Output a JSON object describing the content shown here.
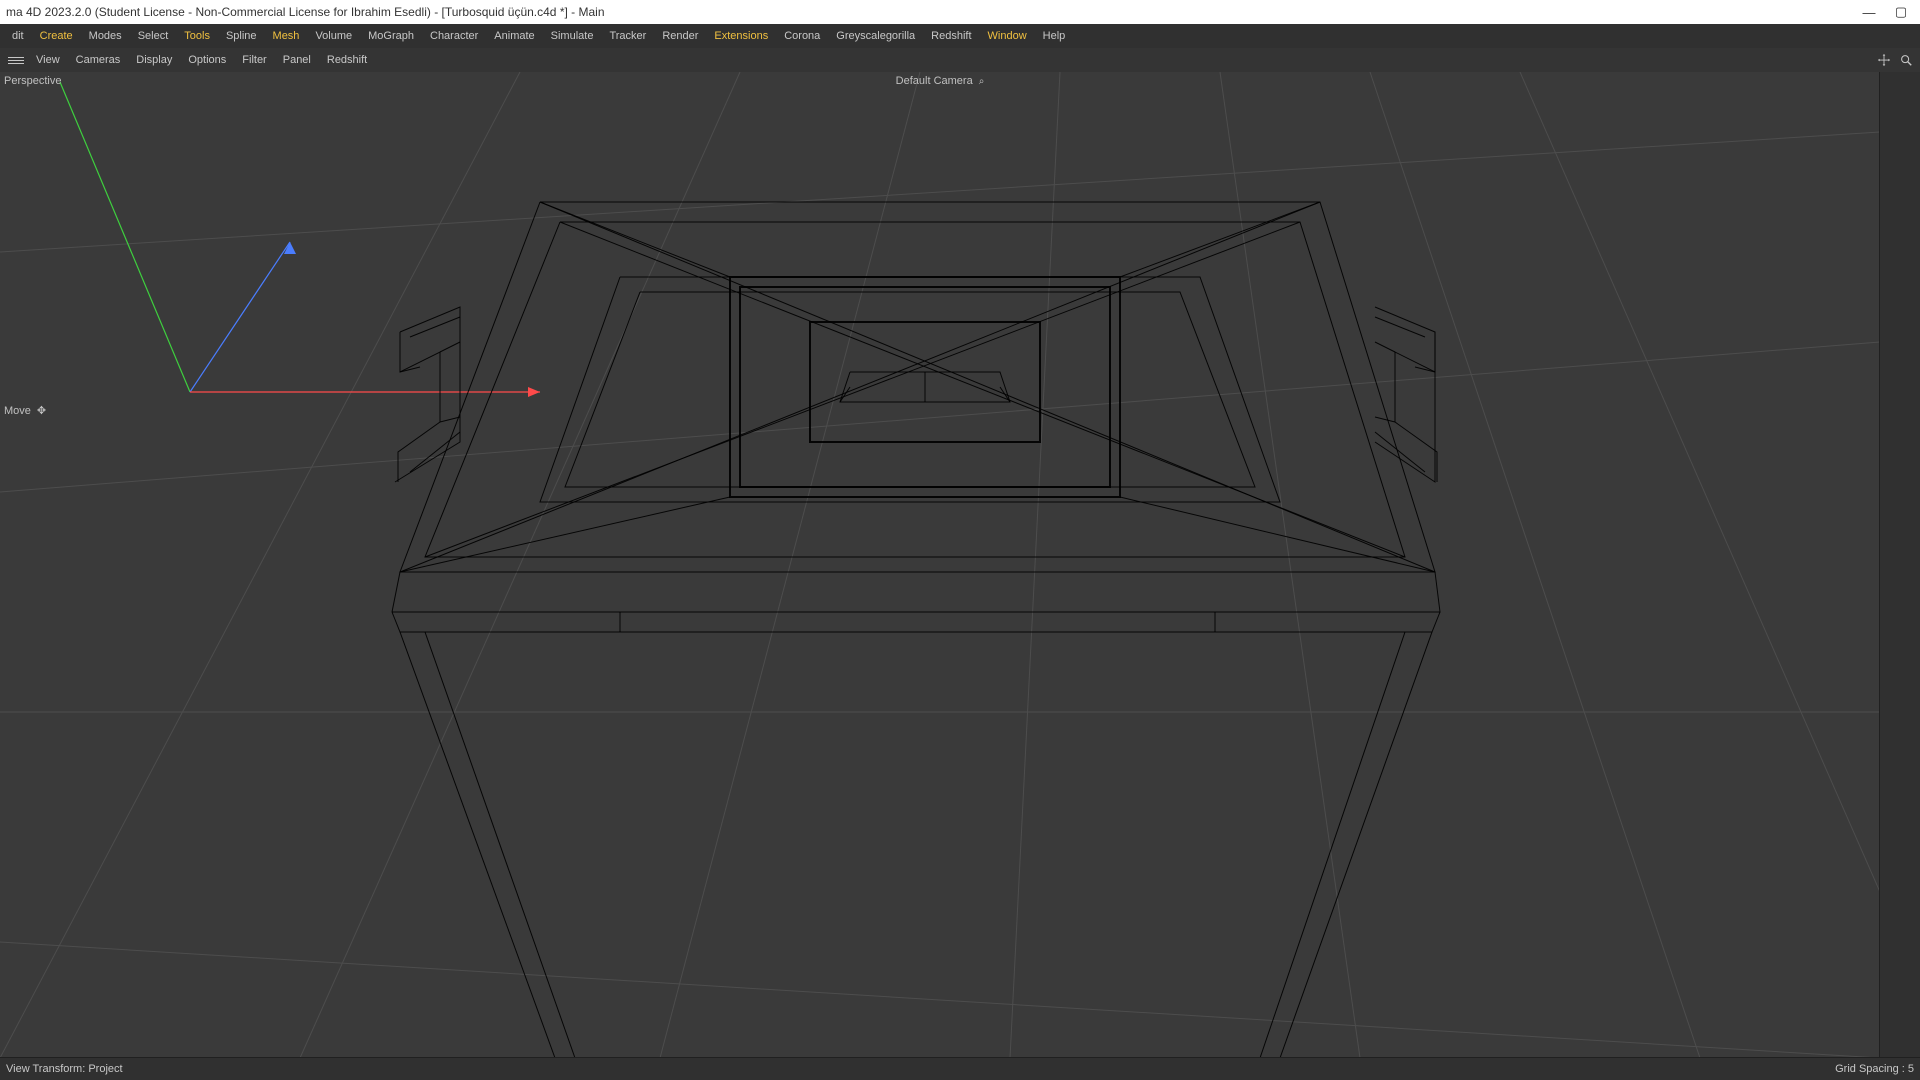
{
  "title_bar": {
    "text": "ma 4D 2023.2.0 (Student License - Non-Commercial License for Ibrahim Esedli) - [Turbosquid üçün.c4d *] - Main"
  },
  "main_menu": {
    "items": [
      {
        "label": "dit",
        "highlight": false
      },
      {
        "label": "Create",
        "highlight": true
      },
      {
        "label": "Modes",
        "highlight": false
      },
      {
        "label": "Select",
        "highlight": false
      },
      {
        "label": "Tools",
        "highlight": true
      },
      {
        "label": "Spline",
        "highlight": false
      },
      {
        "label": "Mesh",
        "highlight": true
      },
      {
        "label": "Volume",
        "highlight": false
      },
      {
        "label": "MoGraph",
        "highlight": false
      },
      {
        "label": "Character",
        "highlight": false
      },
      {
        "label": "Animate",
        "highlight": false
      },
      {
        "label": "Simulate",
        "highlight": false
      },
      {
        "label": "Tracker",
        "highlight": false
      },
      {
        "label": "Render",
        "highlight": false
      },
      {
        "label": "Extensions",
        "highlight": true
      },
      {
        "label": "Corona",
        "highlight": false
      },
      {
        "label": "Greyscalegorilla",
        "highlight": false
      },
      {
        "label": "Redshift",
        "highlight": false
      },
      {
        "label": "Window",
        "highlight": true
      },
      {
        "label": "Help",
        "highlight": false
      }
    ]
  },
  "viewport_menu": {
    "items": [
      {
        "label": "View"
      },
      {
        "label": "Cameras"
      },
      {
        "label": "Display"
      },
      {
        "label": "Options"
      },
      {
        "label": "Filter"
      },
      {
        "label": "Panel"
      },
      {
        "label": "Redshift"
      }
    ]
  },
  "viewport": {
    "view_name": "Perspective",
    "camera_name": "Default Camera",
    "tool_name": "Move"
  },
  "status_bar": {
    "left": "View Transform: Project",
    "right": "Grid Spacing : 5"
  }
}
